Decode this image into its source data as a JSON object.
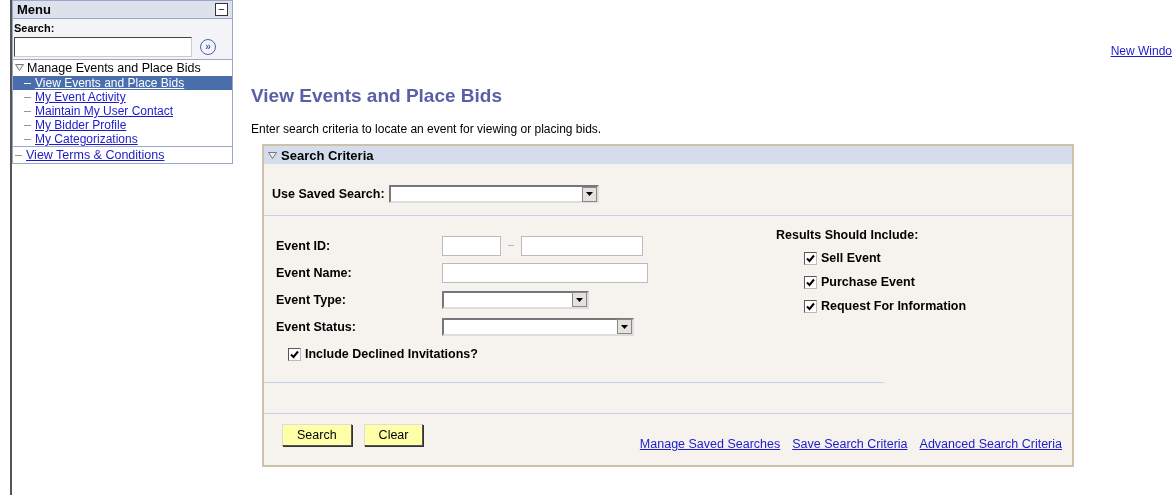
{
  "menu": {
    "title": "Menu",
    "collapse_icon": "−",
    "search": {
      "label": "Search:",
      "go_icon": "»"
    },
    "items": [
      {
        "kind": "folder",
        "label": "Manage Events and Place Bids",
        "expanded": true,
        "children": [
          {
            "label": "View Events and Place Bids",
            "selected": true
          },
          {
            "label": "My Event Activity",
            "selected": false
          },
          {
            "label": "Maintain My User Contact",
            "selected": false
          },
          {
            "label": "My Bidder Profile",
            "selected": false
          },
          {
            "label": "My Categorizations",
            "selected": false
          }
        ]
      },
      {
        "kind": "link",
        "label": "View Terms & Conditions",
        "selected": false
      }
    ]
  },
  "new_window_link": "New Windo",
  "title": "View Events and Place Bids",
  "description": "Enter search criteria to locate an event for viewing or placing bids.",
  "search_criteria": {
    "title": "Search Criteria",
    "expanded": true,
    "saved_search": {
      "label": "Use Saved Search:"
    },
    "fields": [
      {
        "kind": "range",
        "label": "Event ID:"
      },
      {
        "kind": "text",
        "label": "Event Name:"
      },
      {
        "kind": "select",
        "label": "Event Type:"
      },
      {
        "kind": "select_wide",
        "label": "Event Status:"
      }
    ],
    "include_declined": {
      "label": "Include Declined Invitations?",
      "checked": true
    },
    "results_include": {
      "label": "Results Should Include:",
      "options": [
        {
          "label": "Sell Event",
          "checked": true
        },
        {
          "label": "Purchase Event",
          "checked": true
        },
        {
          "label": "Request For Information",
          "checked": true
        }
      ]
    },
    "buttons": [
      "Search",
      "Clear"
    ],
    "links": [
      "Manage Saved Searches",
      "Save Search Criteria",
      "Advanced Search Criteria"
    ]
  }
}
